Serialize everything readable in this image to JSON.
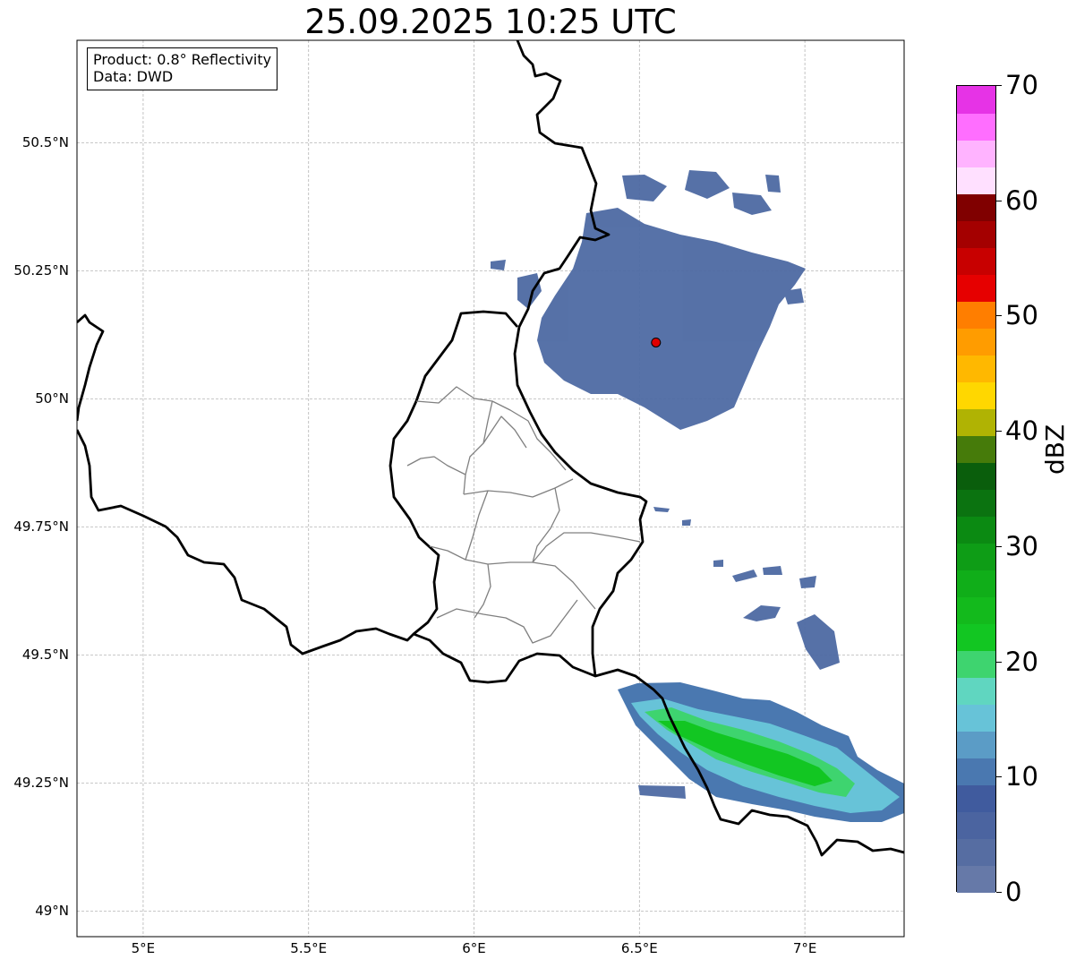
{
  "title": "25.09.2025 10:25 UTC",
  "info": {
    "product_line": "Product: 0.8° Reflectivity",
    "data_line": "Data: DWD"
  },
  "map": {
    "lon_range": [
      4.8,
      7.3
    ],
    "lat_range": [
      48.95,
      50.7
    ],
    "gridlines": true,
    "lon_ticks": [
      {
        "value": 5.0,
        "label": "5°E"
      },
      {
        "value": 5.5,
        "label": "5.5°E"
      },
      {
        "value": 6.0,
        "label": "6°E"
      },
      {
        "value": 6.5,
        "label": "6.5°E"
      },
      {
        "value": 7.0,
        "label": "7°E"
      }
    ],
    "lat_ticks": [
      {
        "value": 50.5,
        "label": "50.5°N"
      },
      {
        "value": 50.25,
        "label": "50.25°N"
      },
      {
        "value": 50.0,
        "label": "50°N"
      },
      {
        "value": 49.75,
        "label": "49.75°N"
      },
      {
        "value": 49.5,
        "label": "49.5°N"
      },
      {
        "value": 49.25,
        "label": "49.25°N"
      },
      {
        "value": 49.0,
        "label": "49°N"
      }
    ],
    "radar_site": {
      "lon": 6.55,
      "lat": 50.11,
      "color": "#e00000"
    },
    "echoes": [
      {
        "region": "north",
        "center": [
          6.55,
          50.17
        ],
        "dbz_range": [
          0,
          10
        ],
        "color": "#4e6aa3"
      },
      {
        "region": "south-east band",
        "center": [
          6.85,
          49.32
        ],
        "dbz_range": [
          0,
          25
        ],
        "color": "#16c01f"
      }
    ]
  },
  "colorbar": {
    "unit": "dBZ",
    "min": 0,
    "max": 70,
    "ticks": [
      {
        "value": 0,
        "label": "0"
      },
      {
        "value": 10,
        "label": "10"
      },
      {
        "value": 20,
        "label": "20"
      },
      {
        "value": 30,
        "label": "30"
      },
      {
        "value": 40,
        "label": "40"
      },
      {
        "value": 50,
        "label": "50"
      },
      {
        "value": 60,
        "label": "60"
      },
      {
        "value": 70,
        "label": "70"
      }
    ],
    "colors": [
      "#6679a8",
      "#566da2",
      "#4b64a0",
      "#405b9e",
      "#4a78b0",
      "#5b9cc6",
      "#67c3d8",
      "#60d6c0",
      "#3ed46f",
      "#12c622",
      "#13ba1c",
      "#10ae19",
      "#0e9d16",
      "#0b8a12",
      "#0b7310",
      "#0a5e0c",
      "#467b0a",
      "#b0b303",
      "#ffd700",
      "#ffb800",
      "#ff9c00",
      "#ff7e00",
      "#e60000",
      "#c80000",
      "#a40000",
      "#800000",
      "#ffe0ff",
      "#ffb3ff",
      "#ff6eff",
      "#e633e6"
    ]
  }
}
